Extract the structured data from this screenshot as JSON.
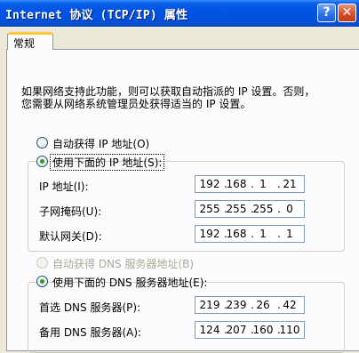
{
  "window": {
    "title": "Internet 协议 (TCP/IP) 属性",
    "help_glyph": "?",
    "close_glyph": "✕"
  },
  "tabs": [
    {
      "label": "常规"
    }
  ],
  "intro": {
    "line1": "如果网络支持此功能，则可以获取自动指派的 IP 设置。否则，",
    "line2": "您需要从网络系统管理员处获得适当的 IP 设置。"
  },
  "ip_mode": {
    "auto_label": "自动获得 IP 地址(O)",
    "manual_label": "使用下面的 IP 地址(S):",
    "selected": "manual"
  },
  "ip_fields": [
    {
      "label": "IP 地址(I):",
      "octets": [
        "192",
        "168",
        "1",
        "21"
      ]
    },
    {
      "label": "子网掩码(U):",
      "octets": [
        "255",
        "255",
        "255",
        "0"
      ]
    },
    {
      "label": "默认网关(D):",
      "octets": [
        "192",
        "168",
        "1",
        "1"
      ]
    }
  ],
  "dns_mode": {
    "auto_label": "自动获得 DNS 服务器地址(B)",
    "manual_label": "使用下面的 DNS 服务器地址(E):",
    "selected": "manual"
  },
  "dns_fields": [
    {
      "label": "首选 DNS 服务器(P):",
      "octets": [
        "219",
        "239",
        "26",
        "42"
      ]
    },
    {
      "label": "备用 DNS 服务器(A):",
      "octets": [
        "124",
        "207",
        "160",
        "110"
      ]
    }
  ],
  "colors": {
    "titlebar": "#0054e3",
    "dialog": "#ece9d8",
    "panel": "#fcfcfe",
    "radio_dot": "#21a121",
    "tab_highlight": "#ffc83c"
  }
}
